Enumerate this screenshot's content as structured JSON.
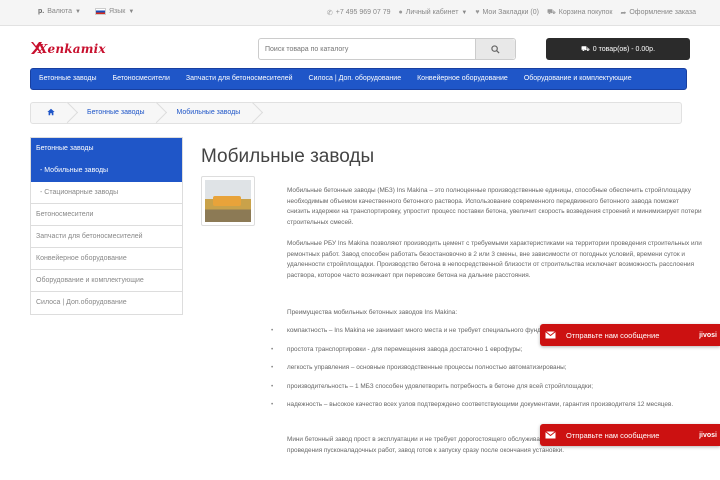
{
  "topbar": {
    "currency_label": "Валюта",
    "currency_symbol": "р.",
    "language_label": "Язык",
    "phone": "+7 495 969 07 79",
    "account": "Личный кабинет",
    "wishlist": "Мои Закладки (0)",
    "cart_link": "Корзина покупок",
    "checkout": "Оформление заказа"
  },
  "header": {
    "logo_text": "Xenkamix",
    "search_placeholder": "Поиск товара по каталогу",
    "cart_summary": "0 товар(ов) - 0.00р."
  },
  "nav": {
    "items": [
      "Бетонные заводы",
      "Бетоносмесители",
      "Запчасти для бетоносмесителей",
      "Силоса | Доп. оборудование",
      "Конвейерное оборудование",
      "Оборудование и комплектующие"
    ]
  },
  "breadcrumb": {
    "items": [
      "Бетонные заводы",
      "Мобильные заводы"
    ]
  },
  "sidebar": {
    "items": [
      "Бетонные заводы",
      "- Мобильные заводы",
      "- Стационарные заводы",
      "Бетоносмесители",
      "Запчасти для бетоносмесителей",
      "Конвейерное оборудование",
      "Оборудование и комплектующие",
      "Силоса | Доп.оборудование"
    ]
  },
  "content": {
    "title": "Мобильные заводы",
    "p1": "Мобильные бетонные заводы (МБЗ) Ins Makina – это полноценные производственные единицы, способные обеспечить стройплощадку необходимым объемом качественного бетонного раствора. Использование современного передвижного бетонного завода поможет снизить издержки на транспортировку, упростит процесс поставки бетона, увеличит скорость возведения строений и минимизирует потери строительных смесей.",
    "p2": "Мобильные РБУ Ins Makina позволяют производить цемент с требуемыми характеристиками на территории проведения строительных или ремонтных работ. Завод способен работать безостановочно в 2 или 3 смены, вне зависимости от погодных условий, времени суток и удаленности стройплощадки. Производство бетона в непосредственной близости от строительства исключает возможность расслоения раствора, которое часто возникает при перевозке бетона на дальние расстояния.",
    "p3": "Преимущества мобильных бетонных заводов Ins Makina:",
    "bullets": [
      "компактность – Ins Makina не занимает много места и не требует специального фундамента для установки;",
      "простота транспортировки - для перемещения завода достаточно 1 еврофуры;",
      "легкость управления – основные производственные процессы полностью автоматизированы;",
      "производительность – 1 МБЗ способен удовлетворить потребность в бетоне для всей стройплощадки;",
      "надежность – высокое качество всех узлов подтверждено соответствующими документами, гарантия производителя 12 месяцев."
    ],
    "p4": "Мини бетонный завод прост в эксплуатации и не требует дорогостоящего обслуживания. При монтаже МБЗ Ins Makina не требуется проведения пусконаладочных работ, завод готов к запуску сразу после окончания установки."
  },
  "chat": {
    "label": "Отправьте нам сообщение",
    "brand": "jivosi"
  }
}
